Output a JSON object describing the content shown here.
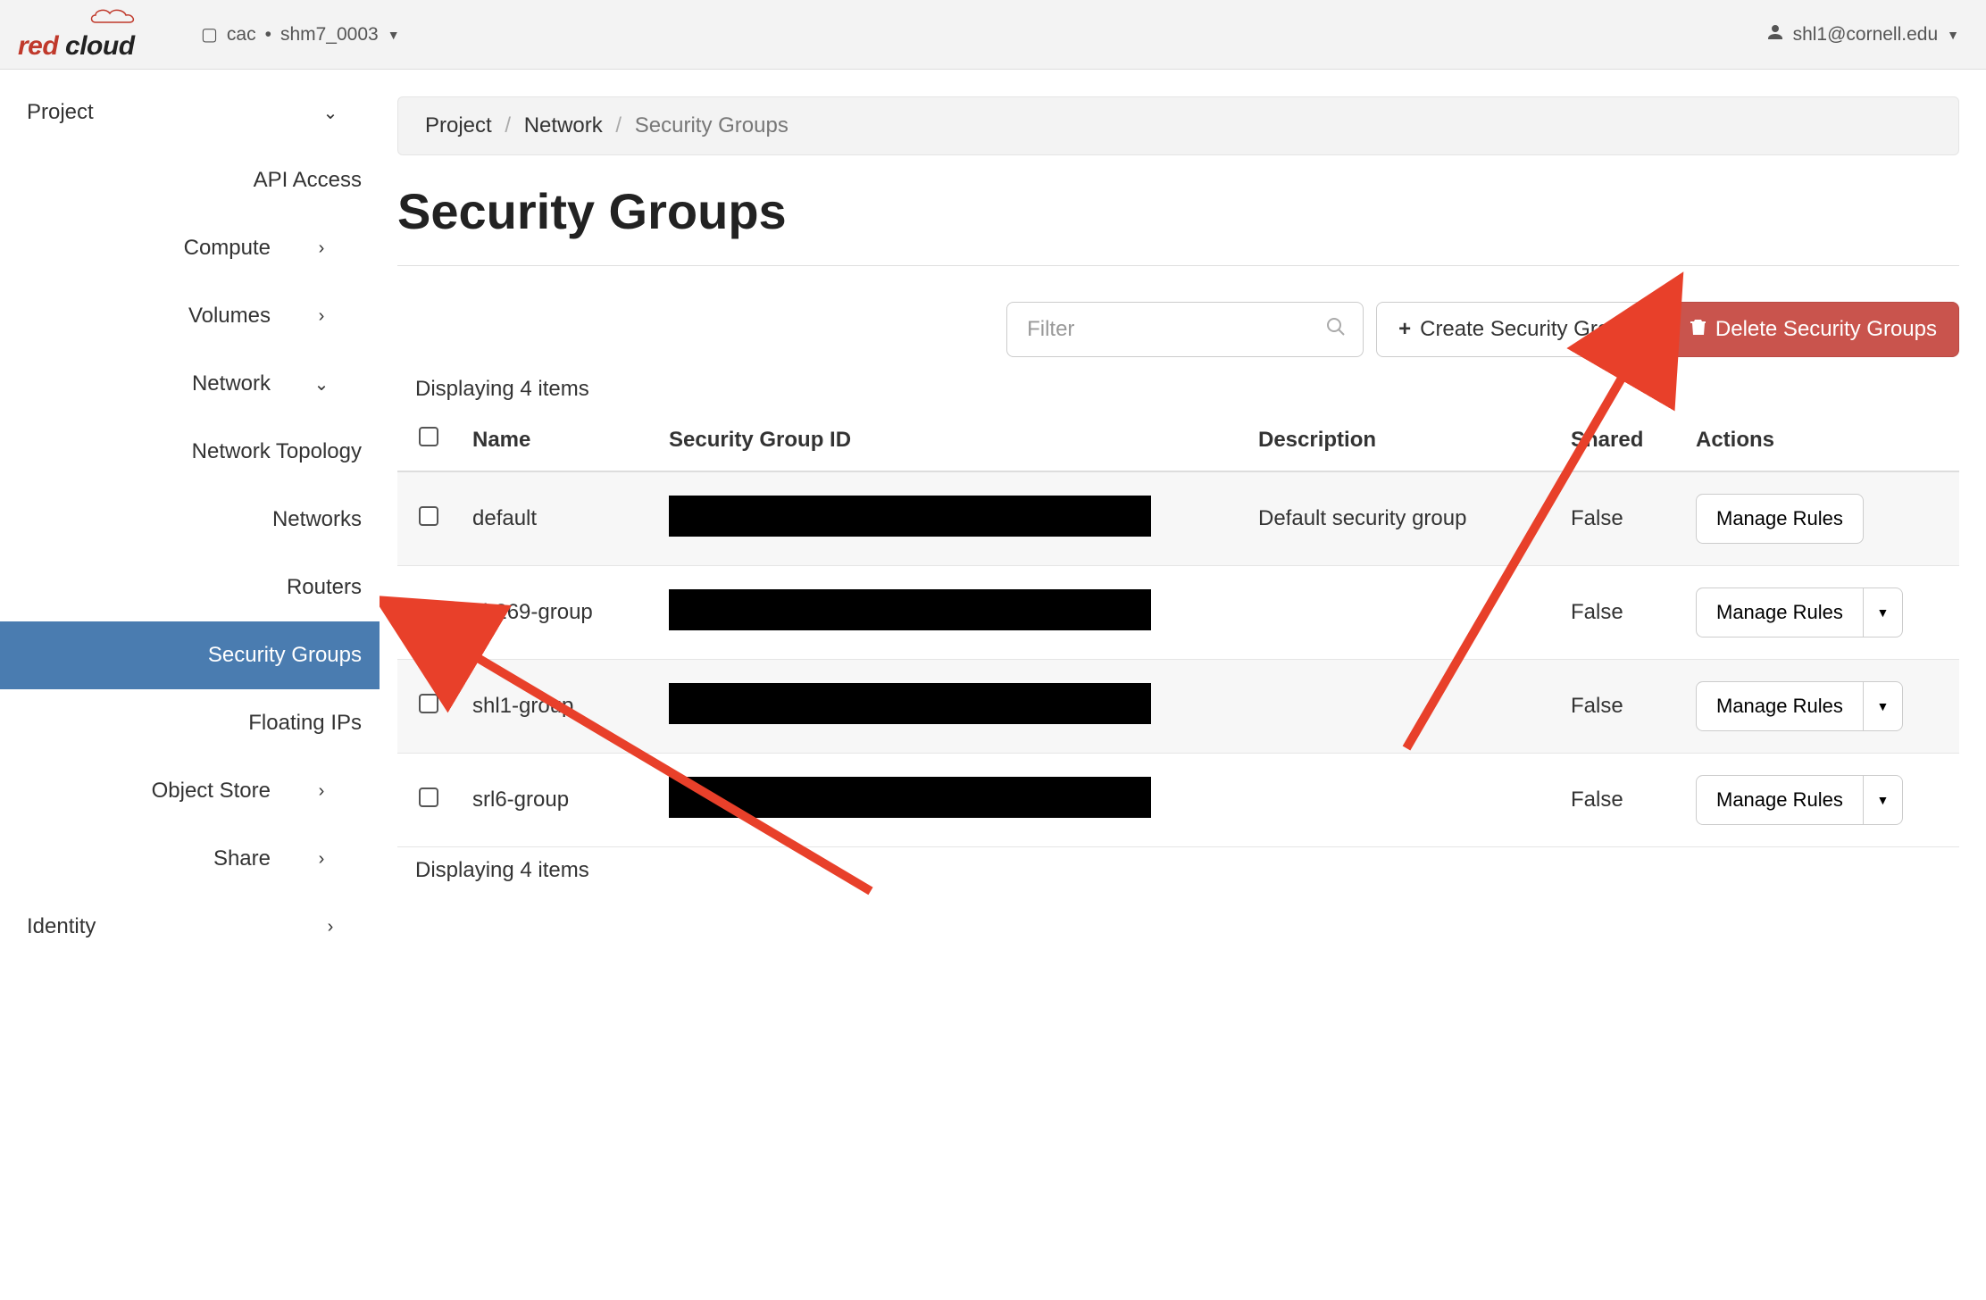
{
  "topbar": {
    "logo_red": "red",
    "logo_cloud": "cloud",
    "project_prefix": "cac",
    "project_name": "shm7_0003",
    "user": "shl1@cornell.edu"
  },
  "sidebar": {
    "project": "Project",
    "api_access": "API Access",
    "compute": "Compute",
    "volumes": "Volumes",
    "network": "Network",
    "network_items": {
      "topology": "Network Topology",
      "networks": "Networks",
      "routers": "Routers",
      "security_groups": "Security Groups",
      "floating_ips": "Floating IPs"
    },
    "object_store": "Object Store",
    "share": "Share",
    "identity": "Identity"
  },
  "breadcrumb": {
    "project": "Project",
    "network": "Network",
    "current": "Security Groups"
  },
  "page": {
    "title": "Security Groups",
    "filter_placeholder": "Filter",
    "create_btn": "Create Security Group",
    "delete_btn": "Delete Security Groups",
    "displaying": "Displaying 4 items"
  },
  "table": {
    "headers": {
      "name": "Name",
      "id": "Security Group ID",
      "description": "Description",
      "shared": "Shared",
      "actions": "Actions"
    },
    "manage_rules": "Manage Rules",
    "rows": [
      {
        "checked": false,
        "name": "default",
        "description": "Default security group",
        "shared": "False",
        "has_dropdown": false
      },
      {
        "checked": true,
        "name": "kb269-group",
        "description": "",
        "shared": "False",
        "has_dropdown": true
      },
      {
        "checked": false,
        "name": "shl1-group",
        "description": "",
        "shared": "False",
        "has_dropdown": true
      },
      {
        "checked": false,
        "name": "srl6-group",
        "description": "",
        "shared": "False",
        "has_dropdown": true
      }
    ]
  }
}
